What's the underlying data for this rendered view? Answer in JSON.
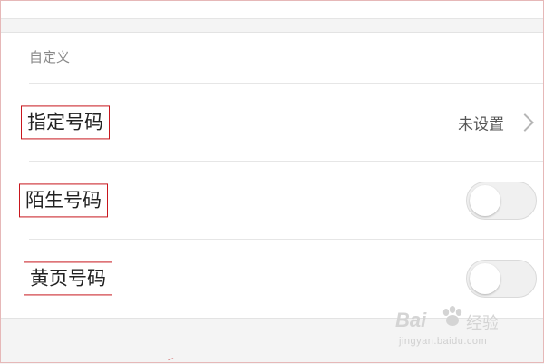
{
  "section": {
    "header": "自定义"
  },
  "rows": [
    {
      "label": "指定号码",
      "value": "未设置",
      "control": "chevron-right-icon"
    },
    {
      "label": "陌生号码",
      "control": "toggle",
      "toggle_on": false
    },
    {
      "label": "黄页号码",
      "control": "toggle",
      "toggle_on": false
    }
  ],
  "watermark": {
    "logo": "Bai",
    "text": "经验",
    "url": "jingyan.baidu.com"
  },
  "colors": {
    "highlight_border": "#c8161d",
    "background": "#f4f4f4",
    "card": "#ffffff"
  }
}
